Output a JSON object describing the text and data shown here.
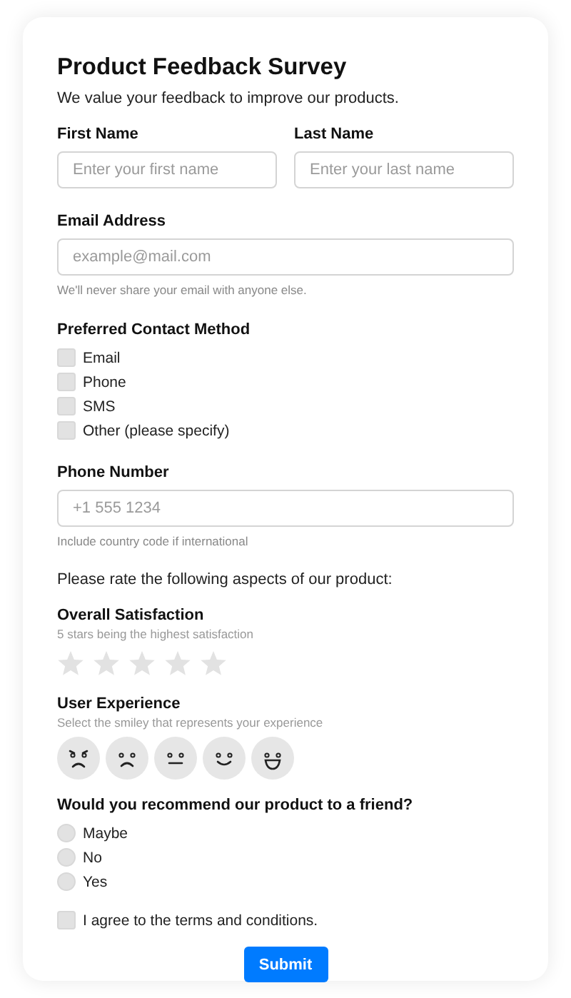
{
  "title": "Product Feedback Survey",
  "subtitle": "We value your feedback to improve our products.",
  "name_fields": [
    {
      "label": "First Name",
      "placeholder": "Enter your first name"
    },
    {
      "label": "Last Name",
      "placeholder": "Enter your last name"
    }
  ],
  "email": {
    "label": "Email Address",
    "placeholder": "example@mail.com",
    "hint": "We'll never share your email with anyone else."
  },
  "contact_method": {
    "label": "Preferred Contact Method",
    "options": [
      {
        "label": "Email",
        "checked": false
      },
      {
        "label": "Phone",
        "checked": false
      },
      {
        "label": "SMS",
        "checked": false
      },
      {
        "label": "Other (please specify)",
        "checked": false
      }
    ]
  },
  "phone": {
    "label": "Phone Number",
    "placeholder": "+1 555 1234",
    "hint": "Include country code if international"
  },
  "rating_intro": "Please rate the following aspects of our product:",
  "overall_satisfaction": {
    "label": "Overall Satisfaction",
    "hint": "5 stars being the highest satisfaction",
    "stars": 0
  },
  "user_experience": {
    "label": "User Experience",
    "hint": "Select the smiley that represents your experience",
    "faces": [
      {
        "kind": "angry",
        "selected": false
      },
      {
        "kind": "sad",
        "selected": false
      },
      {
        "kind": "neutral",
        "selected": false
      },
      {
        "kind": "smile",
        "selected": false
      },
      {
        "kind": "grin",
        "selected": false
      }
    ]
  },
  "recommend": {
    "label": "Would you recommend our product to a friend?",
    "options": [
      {
        "label": "Maybe",
        "selected": false
      },
      {
        "label": "No",
        "selected": false
      },
      {
        "label": "Yes",
        "selected": false
      }
    ]
  },
  "terms": {
    "label": "I agree to the terms and conditions.",
    "checked": false
  },
  "submit": "Submit"
}
